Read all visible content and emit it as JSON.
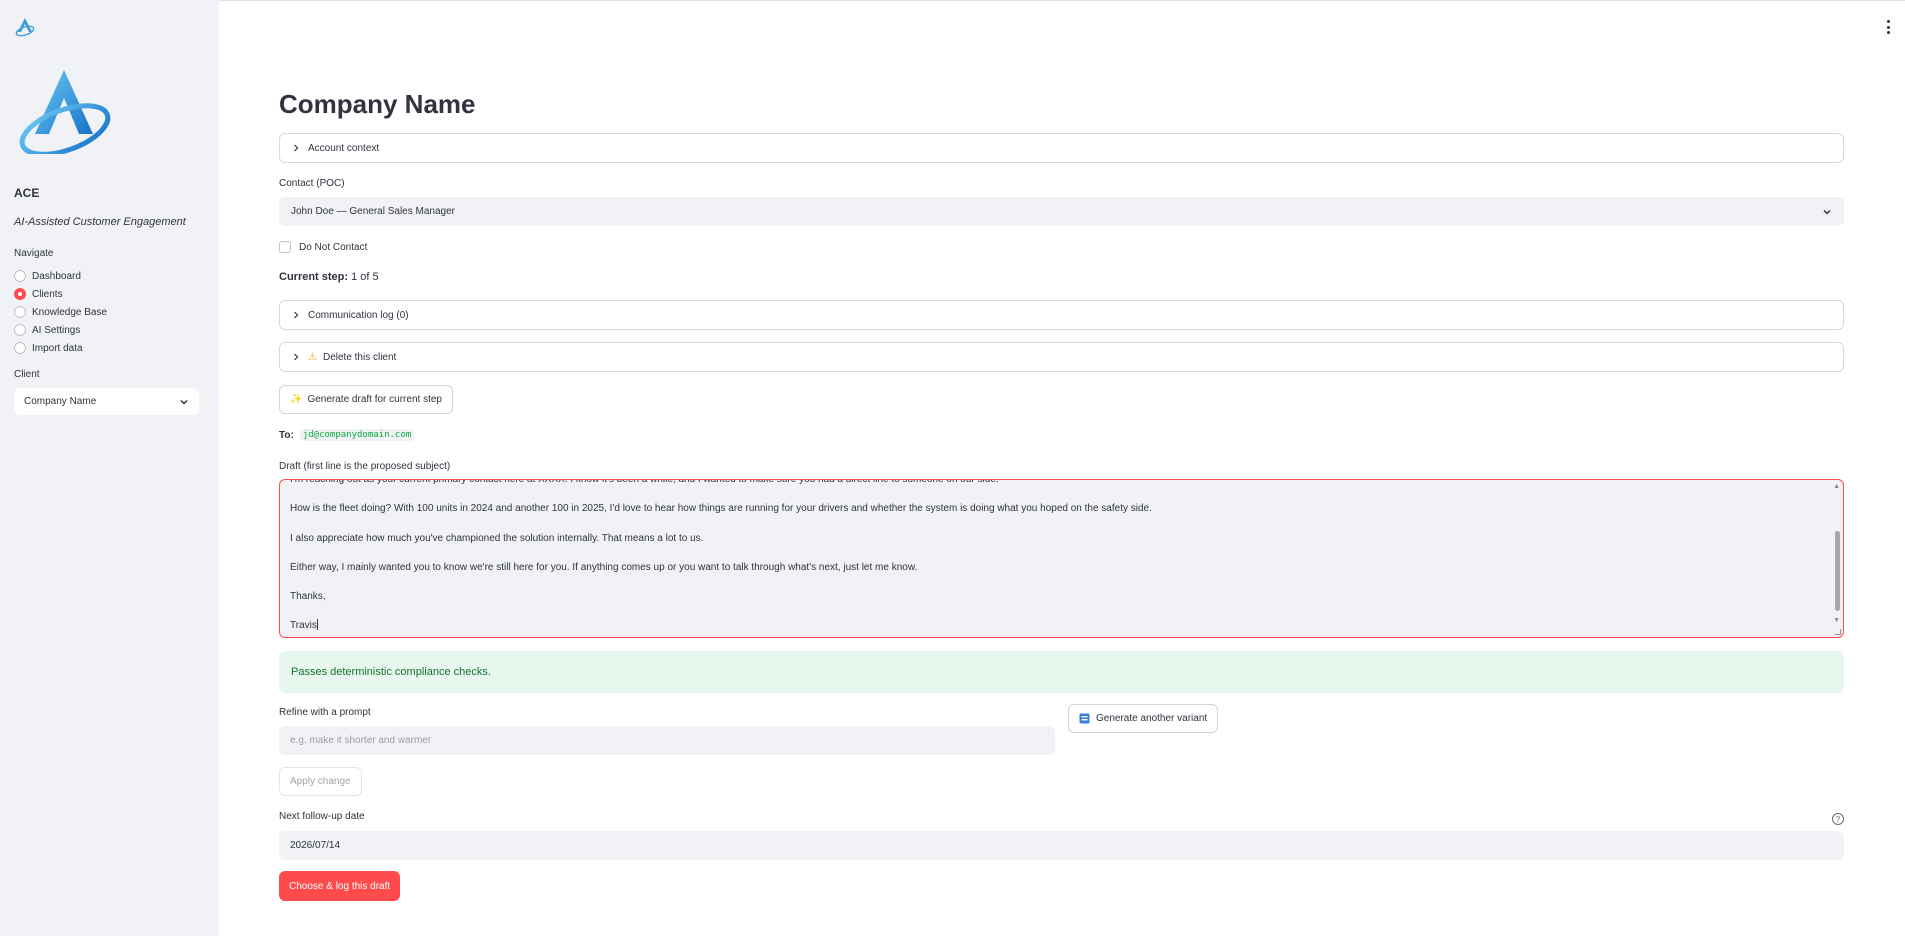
{
  "sidebar": {
    "app_name": "ACE",
    "tagline": "AI-Assisted Customer Engagement",
    "nav_label": "Navigate",
    "nav_items": [
      {
        "label": "Dashboard",
        "selected": false
      },
      {
        "label": "Clients",
        "selected": true
      },
      {
        "label": "Knowledge Base",
        "selected": false
      },
      {
        "label": "AI Settings",
        "selected": false
      },
      {
        "label": "Import data",
        "selected": false
      }
    ],
    "client_label": "Client",
    "client_value": "Company Name"
  },
  "main": {
    "title": "Company Name",
    "account_context": "Account context",
    "contact_label": "Contact (POC)",
    "contact_value": "John Doe — General Sales Manager",
    "do_not_contact": "Do Not Contact",
    "current_step_label": "Current step:",
    "current_step_value": "1 of 5",
    "communication_log": "Communication log (0)",
    "delete_client": "Delete this client",
    "generate_draft": "Generate draft for current step",
    "to_label": "To:",
    "to_email": "jd@companydomain.com",
    "draft_label": "Draft (first line is the proposed subject)",
    "draft_lines": [
      "I'm reaching out as your current primary contact here at XXXX. I know it's been a while, and I wanted to make sure you had a direct line to someone on our side.",
      "How is the fleet doing? With 100 units in 2024 and another 100 in 2025, I'd love to hear how things are running for your drivers and whether the system is doing what you hoped on the safety side.",
      "I also appreciate how much you've championed the solution internally. That means a lot to us.",
      "Either way, I mainly wanted you to know we're still here for you. If anything comes up or you want to talk through what's next, just let me know.",
      "Thanks,",
      "Travis"
    ],
    "compliance_message": "Passes deterministic compliance checks.",
    "refine_label": "Refine with a prompt",
    "refine_placeholder": "e.g. make it shorter and warmer",
    "generate_variant": "Generate another variant",
    "apply_change": "Apply change",
    "followup_label": "Next follow-up date",
    "followup_value": "2026/07/14",
    "choose_log": "Choose & log this draft"
  },
  "colors": {
    "accent": "#ff4b4b",
    "sidebar_bg": "#f0f2f6",
    "success_bg": "#e8f7ee",
    "success_text": "#177233",
    "code_green": "#09ab3b"
  }
}
